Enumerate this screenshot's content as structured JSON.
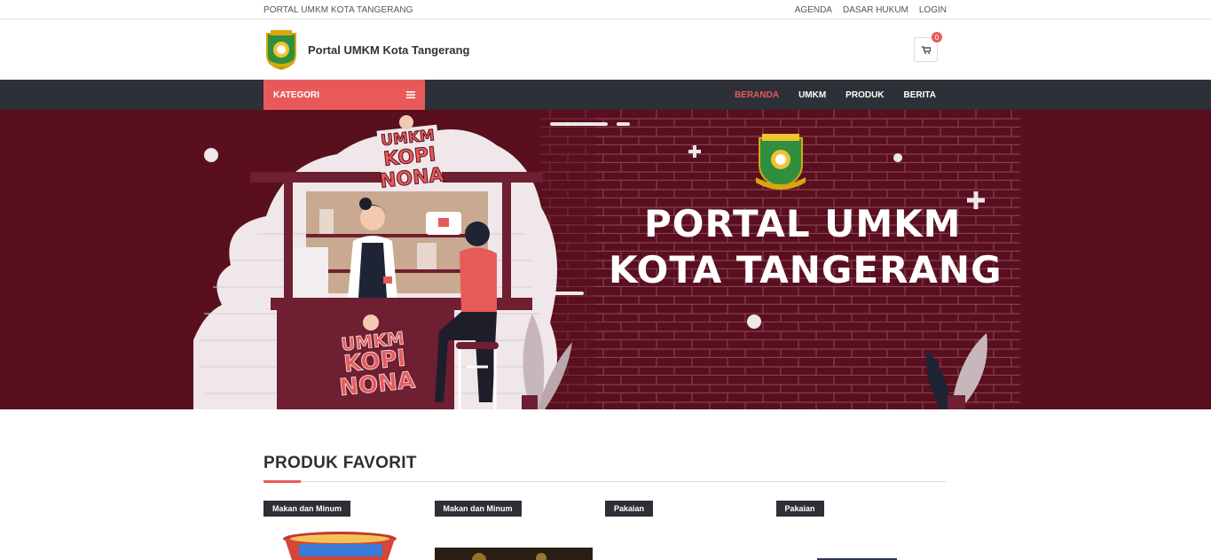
{
  "topbar": {
    "site_title": "PORTAL UMKM KOTA TANGERANG",
    "links": [
      "AGENDA",
      "DASAR HUKUM",
      "LOGIN"
    ]
  },
  "header": {
    "brand_name": "Portal UMKM Kota Tangerang",
    "cart_count": "0"
  },
  "nav": {
    "category_label": "KATEGORI",
    "menu": [
      "BERANDA",
      "UMKM",
      "PRODUK",
      "BERITA"
    ],
    "active": "BERANDA"
  },
  "hero": {
    "line1": "PORTAL UMKM",
    "line2": "KOTA TANGERANG",
    "sign_top": [
      "UMKM",
      "KOPI",
      "NONA"
    ],
    "sign_bottom": [
      "UMKM",
      "KOPI",
      "NONA"
    ],
    "emblem_text": "KOTA TANGERANG"
  },
  "products_section": {
    "title": "PRODUK FAVORIT",
    "items": [
      {
        "category": "Makan dan Minum"
      },
      {
        "category": "Makan dan Minum"
      },
      {
        "category": "Pakaian"
      },
      {
        "category": "Pakaian"
      }
    ]
  },
  "colors": {
    "accent": "#e85a5a",
    "dark": "#2d3036",
    "hero_bg": "#5a0f1f"
  }
}
